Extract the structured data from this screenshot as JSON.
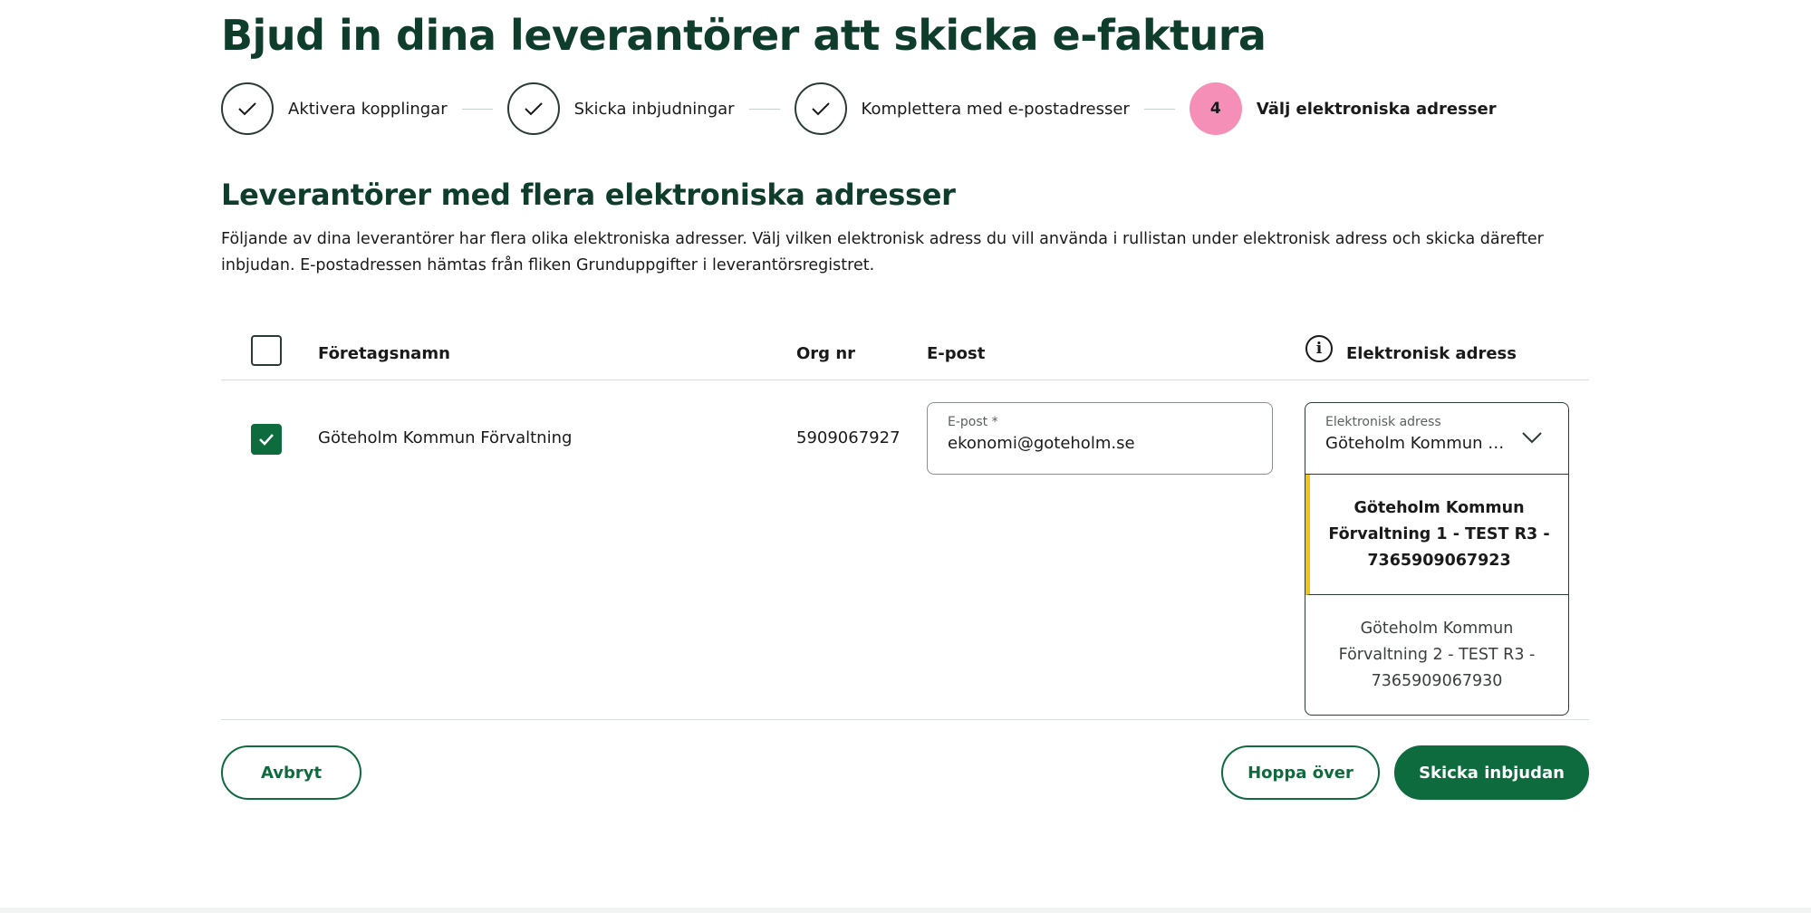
{
  "page": {
    "title": "Bjud in dina leverantörer att skicka e-faktura"
  },
  "stepper": {
    "steps": [
      {
        "label": "Aktivera kopplingar",
        "state": "done"
      },
      {
        "label": "Skicka inbjudningar",
        "state": "done"
      },
      {
        "label": "Komplettera med e-postadresser",
        "state": "done"
      },
      {
        "label": "Välj elektroniska adresser",
        "state": "active",
        "number": "4"
      }
    ]
  },
  "section": {
    "title": "Leverantörer med flera elektroniska adresser",
    "description": "Följande av dina leverantörer har flera olika elektroniska adresser. Välj vilken elektronisk adress du vill använda i rullistan under elektronisk adress och skicka därefter inbjudan. E-postadressen hämtas från fliken Grunduppgifter i leverantörsregistret."
  },
  "table": {
    "headers": {
      "company": "Företagsnamn",
      "org": "Org nr",
      "email": "E-post",
      "eaddress": "Elektronisk adress"
    },
    "select_all_checked": false,
    "rows": [
      {
        "checked": true,
        "company": "Göteholm Kommun Förvaltning",
        "org": "5909067927",
        "email_label": "E-post *",
        "email_value": "ekonomi@goteholm.se",
        "eaddress_label": "Elektronisk adress",
        "eaddress_value": "Göteholm Kommun F...",
        "options": [
          {
            "label": "Göteholm Kommun Förvaltning 1 - TEST R3 - 7365909067923",
            "selected": true
          },
          {
            "label": "Göteholm Kommun Förvaltning 2 - TEST R3 - 7365909067930",
            "selected": false
          }
        ]
      }
    ]
  },
  "actions": {
    "cancel": "Avbryt",
    "skip": "Hoppa över",
    "send": "Skicka inbjudan"
  },
  "colors": {
    "brand_green": "#0d6b3d",
    "title_green": "#0f3d2c",
    "active_step": "#f58fb8",
    "selected_marker": "#f0c419"
  }
}
